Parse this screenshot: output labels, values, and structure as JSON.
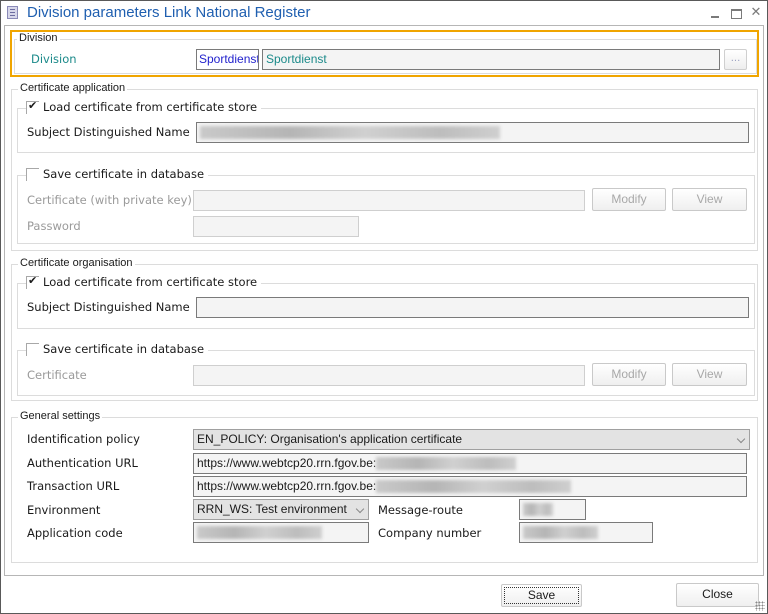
{
  "window": {
    "title": "Division parameters Link National Register",
    "controls": {
      "minimize": "minimize",
      "maximize": "maximize",
      "close": "✕"
    }
  },
  "division": {
    "group_title": "Division",
    "label": "Division",
    "code_value": "Sportdienst",
    "name_value": "Sportdienst",
    "browse_label": "..."
  },
  "certificate_application": {
    "group_title": "Certificate application",
    "load_store": {
      "label": "Load certificate from certificate store",
      "checked": true,
      "subject_label": "Subject Distinguished Name",
      "subject_value": "[blurred]"
    },
    "save_db": {
      "label": "Save certificate in database",
      "checked": false,
      "certificate_label": "Certificate (with private key)",
      "certificate_value": "",
      "password_label": "Password",
      "password_value": "",
      "modify_label": "Modify",
      "view_label": "View"
    }
  },
  "certificate_organisation": {
    "group_title": "Certificate organisation",
    "load_store": {
      "label": "Load certificate from certificate store",
      "checked": true,
      "subject_label": "Subject Distinguished Name",
      "subject_value": ""
    },
    "save_db": {
      "label": "Save certificate in database",
      "checked": false,
      "certificate_label": "Certificate",
      "certificate_value": "",
      "modify_label": "Modify",
      "view_label": "View"
    }
  },
  "general_settings": {
    "group_title": "General settings",
    "identification_policy": {
      "label": "Identification policy",
      "value": "EN_POLICY: Organisation's application certificate"
    },
    "authentication_url": {
      "label": "Authentication URL",
      "value": "https://www.webtcp20.rrn.fgov.be:"
    },
    "transaction_url": {
      "label": "Transaction URL",
      "value": "https://www.webtcp20.rrn.fgov.be:"
    },
    "environment": {
      "label": "Environment",
      "value": "RRN_WS: Test environment"
    },
    "message_route": {
      "label": "Message-route",
      "value": "[blurred]"
    },
    "application_code": {
      "label": "Application code",
      "value": "[blurred]"
    },
    "company_number": {
      "label": "Company number",
      "value": "[blurred]"
    }
  },
  "footer": {
    "save_label": "Save",
    "close_label": "Close"
  },
  "colors": {
    "title": "#1f5fb0",
    "highlight": "#f0a500",
    "division_label": "#1b8a8a",
    "code_text": "#1f1fcc"
  }
}
